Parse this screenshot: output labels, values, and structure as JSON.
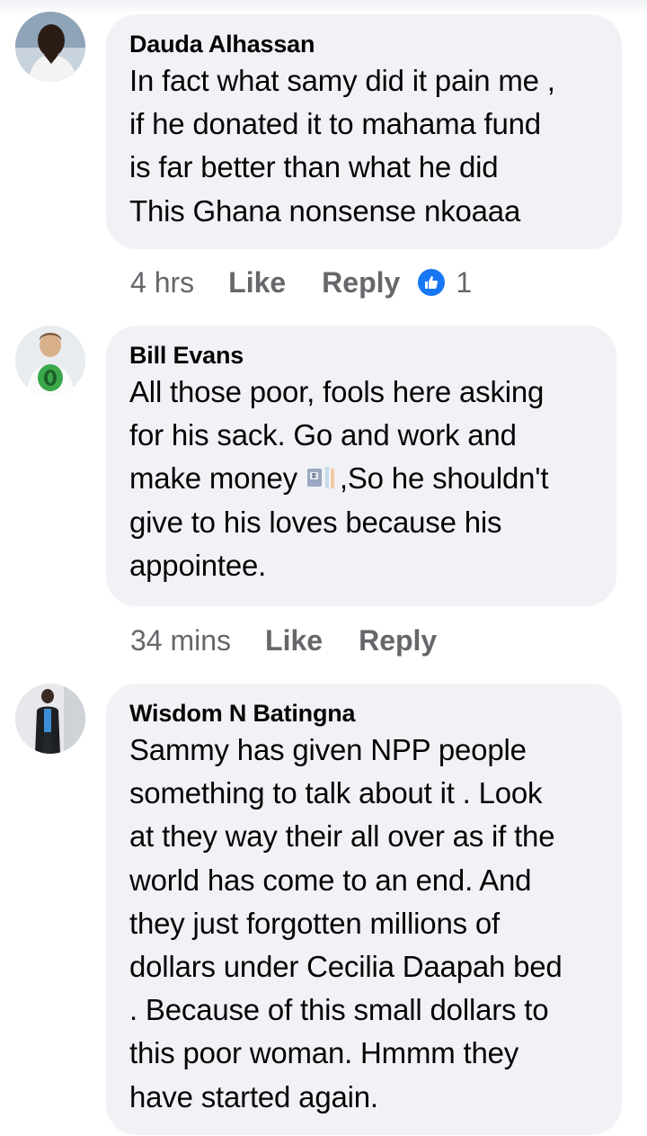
{
  "comments": [
    {
      "author": "Dauda Alhassan",
      "text": "In fact what samy did it pain me ,\nif he donated it to mahama fund\nis far better than what he did\nThis Ghana nonsense nkoaaa",
      "time": "4 hrs",
      "like_label": "Like",
      "reply_label": "Reply",
      "reaction_icon": "like-icon",
      "reaction_count": "1"
    },
    {
      "author": "Bill Evans",
      "text_before_emoji": "All those poor, fools here asking\nfor his sack. Go and work and\nmake money ",
      "emoji": "money-with-wings-icon",
      "text_after_emoji": ",So he shouldn't\ngive to his loves because his\nappointee.",
      "time": "34 mins",
      "like_label": "Like",
      "reply_label": "Reply"
    },
    {
      "author": "Wisdom N Batingna",
      "text": "Sammy has given NPP people\nsomething to talk about it . Look\nat they way their all over as if the\nworld has come to an end. And\nthey just forgotten millions of\ndollars under Cecilia Daapah bed\n. Because of this small dollars to\nthis poor woman. Hmmm they\nhave started again.",
      "time": "",
      "like_label": "",
      "reply_label": ""
    }
  ],
  "colors": {
    "bubble": "#f0f2f5",
    "meta_text": "#65676b",
    "like_blue": "#1877f2"
  }
}
